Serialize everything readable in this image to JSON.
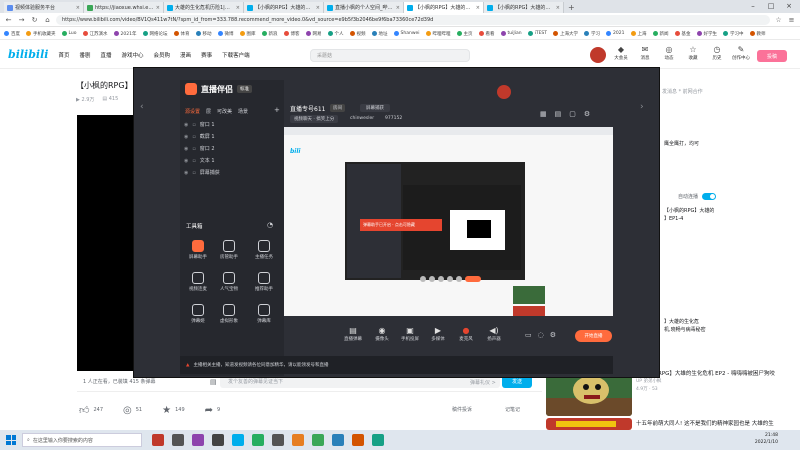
{
  "browser": {
    "tabs": [
      {
        "label": "视频体验服务平台",
        "color": "#5b8def",
        "active": false
      },
      {
        "label": "https://jiaoxue.whsi.edu.cn/d",
        "color": "#3aa757",
        "active": false
      },
      {
        "label": "大雄的生化危机历险1|小枫_bilibili",
        "color": "#00aeec",
        "active": false
      },
      {
        "label": "【小枫的RPG】大雄的生化危机",
        "color": "#00aeec",
        "active": false
      },
      {
        "label": "直播小枫的个人空间_哔哩哔哩",
        "color": "#00aeec",
        "active": false
      },
      {
        "label": "【小枫的RPG】大雄的生化危",
        "color": "#00aeec",
        "active": true
      },
      {
        "label": "【小枫的RPG】大雄的生化危机",
        "color": "#00aeec",
        "active": false
      }
    ],
    "url": "https://www.bilibili.com/video/BV1Qs411w7tN/?spm_id_from=333.788.recommend_more_video.0&vd_source=e9b5f3b2046be9f6ba73360ce72d39d",
    "bookmarks": [
      "百度",
      "手机收藏夹",
      "Luo",
      "江苏演水",
      "2021年",
      "网络论坛",
      "体育",
      "移动",
      "微博",
      "图库",
      "新浪",
      "博客",
      "网易",
      "个人",
      "视频",
      "地址",
      "Shanwei",
      "哔哩哔哩",
      "主页",
      "看看",
      "tuiJian",
      "iTEST",
      "上海大学",
      "学习",
      "2021",
      "上海",
      "新闻",
      "基金",
      "好学生",
      "学习中",
      "教师"
    ]
  },
  "bilibili": {
    "logo": "bilibili",
    "nav": [
      "首页",
      "番剧",
      "直播",
      "游戏中心",
      "会员购",
      "漫画",
      "赛事",
      "下载客户端"
    ],
    "search_placeholder": "采蘑菇",
    "right_icons": [
      {
        "label": "大会员",
        "glyph": "◆"
      },
      {
        "label": "消息",
        "glyph": "✉"
      },
      {
        "label": "动态",
        "glyph": "◎"
      },
      {
        "label": "收藏",
        "glyph": "☆"
      },
      {
        "label": "历史",
        "glyph": "◷"
      },
      {
        "label": "创作中心",
        "glyph": "✎"
      }
    ],
    "upload_label": "投稿"
  },
  "video": {
    "title": "【小枫的RPG】",
    "meta_views": "2.9万",
    "meta_danmu": "415",
    "online_text": "1 人正在看，已装填 415 条弹幕",
    "danmu_placeholder": "发个友善的弹幕见证当下",
    "danmu_rules": "弹幕礼仪 >",
    "send_label": "发送",
    "likes": "247",
    "coins": "51",
    "favorites": "149",
    "shares": "9",
    "report_label": "稿件投诉",
    "notes_label": "记笔记"
  },
  "right": {
    "uploader_note": "发消息 * 前网合作",
    "snippet_1": "鹰全鹰打，均可",
    "snippet_2": "【小枫的RPG】大雄的",
    "snippet_3": "】EP1-4",
    "autoplay_label": "自动连播",
    "snippet_4": "】大雄的生化危",
    "snippet_5": "机,晓畅与病毒秘密",
    "recs": [
      {
        "title": "【小枫的RPG】大雄的生化危机 EP2 - 嗨嗨嗨被困尸狗咬",
        "author": "UP 弟弟小枫",
        "stats": "4.9万 · 53"
      },
      {
        "title": "十五年前萌大同人! 这不是我们的精神家园也是 大雄的生",
        "author": "UP 弟弟小枫",
        "stats": ""
      }
    ]
  },
  "obs": {
    "app_name": "直播伴侣",
    "version": "标准",
    "tabs": [
      "源设置",
      "层",
      "可改美",
      "场景"
    ],
    "scenes": [
      "窗口 1",
      "截屏 1",
      "窗口 2",
      "文本 1",
      "屏幕捕获"
    ],
    "tools_title": "工具箱",
    "tools": [
      "屏幕助手",
      "房管助手",
      "主播任务",
      "视频连麦",
      "人气宝物",
      "推荐助手",
      "弹幕姬",
      "虚拟形象",
      "弹幕库"
    ],
    "room_title": "直播专号611",
    "room_tag": "房间",
    "room_category": "屏幕捕获",
    "room_line2_a": "视频聊天 · 搞笑上分",
    "room_line2_b": "chinwesler",
    "room_line2_c": "977152",
    "popup_text": "弹幕助手已开启 · 点击可隐藏",
    "bottom_tools": [
      {
        "label": "直播弹幕",
        "glyph": "▤"
      },
      {
        "label": "摄像头",
        "glyph": "◉"
      },
      {
        "label": "手机投屏",
        "glyph": "▣"
      },
      {
        "label": "多媒体",
        "glyph": "▶"
      },
      {
        "label": "麦克风",
        "glyph": "●"
      },
      {
        "label": "扬声器",
        "glyph": "◀)"
      }
    ],
    "golive_label": "开始直播",
    "status_text": "主播相关主播，知道发视频请各位同意加精华，请以能领发号和直播"
  },
  "taskbar": {
    "search_placeholder": "在这里输入你要搜索的内容",
    "time": "21:48",
    "date": "2022/1/10",
    "app_colors": [
      "#c0392b",
      "#555",
      "#8e44ad",
      "#444",
      "#00aeec",
      "#27ae60",
      "#555",
      "#e67e22",
      "#3aa757",
      "#2980b9",
      "#d35400",
      "#16a085"
    ]
  }
}
